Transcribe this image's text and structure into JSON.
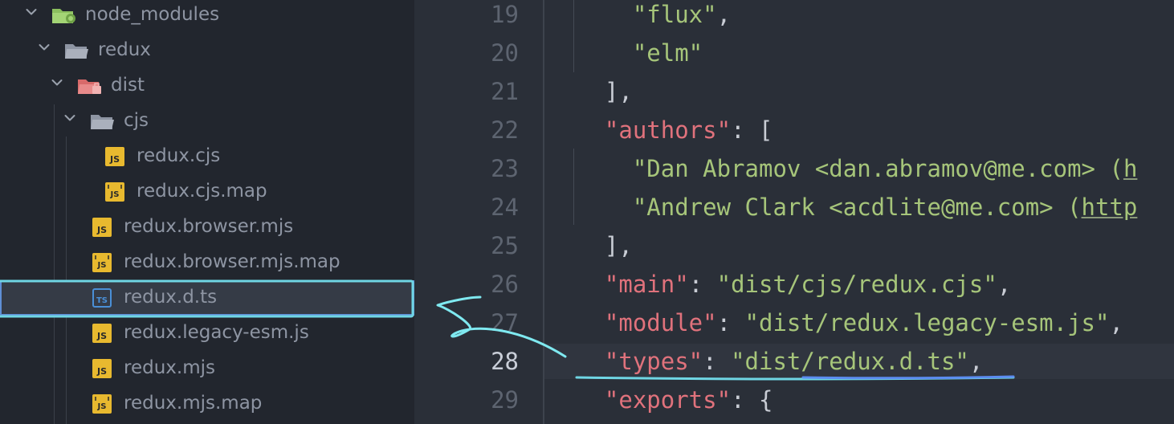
{
  "explorer": {
    "items": [
      {
        "label": "node_modules",
        "kind": "folder",
        "icon": "folder-node-icon",
        "expanded": true,
        "depth": 0
      },
      {
        "label": "redux",
        "kind": "folder",
        "icon": "folder-icon",
        "expanded": true,
        "depth": 1
      },
      {
        "label": "dist",
        "kind": "folder",
        "icon": "folder-dist-icon",
        "expanded": true,
        "depth": 2
      },
      {
        "label": "cjs",
        "kind": "folder",
        "icon": "folder-icon",
        "expanded": true,
        "depth": 3
      },
      {
        "label": "redux.cjs",
        "kind": "file",
        "icon": "js-file-icon",
        "depth": 4
      },
      {
        "label": "redux.cjs.map",
        "kind": "file",
        "icon": "js-map-file-icon",
        "depth": 4
      },
      {
        "label": "redux.browser.mjs",
        "kind": "file",
        "icon": "js-file-icon",
        "depth": 3
      },
      {
        "label": "redux.browser.mjs.map",
        "kind": "file",
        "icon": "js-map-file-icon",
        "depth": 3
      },
      {
        "label": "redux.d.ts",
        "kind": "file",
        "icon": "ts-file-icon",
        "depth": 3,
        "selected": true
      },
      {
        "label": "redux.legacy-esm.js",
        "kind": "file",
        "icon": "js-file-icon",
        "depth": 3
      },
      {
        "label": "redux.mjs",
        "kind": "file",
        "icon": "js-file-icon",
        "depth": 3
      },
      {
        "label": "redux.mjs.map",
        "kind": "file",
        "icon": "js-map-file-icon",
        "depth": 3
      }
    ]
  },
  "editor": {
    "current_line": 28,
    "lines": [
      {
        "number": "19",
        "tokens": [
          {
            "t": "    ",
            "c": "punc"
          },
          {
            "t": "\"flux\"",
            "c": "str"
          },
          {
            "t": ",",
            "c": "punc"
          }
        ]
      },
      {
        "number": "20",
        "tokens": [
          {
            "t": "    ",
            "c": "punc"
          },
          {
            "t": "\"elm\"",
            "c": "str"
          }
        ]
      },
      {
        "number": "21",
        "tokens": [
          {
            "t": "  ],",
            "c": "punc"
          }
        ]
      },
      {
        "number": "22",
        "tokens": [
          {
            "t": "  ",
            "c": "punc"
          },
          {
            "t": "\"authors\"",
            "c": "key"
          },
          {
            "t": ": [",
            "c": "punc"
          }
        ]
      },
      {
        "number": "23",
        "tokens": [
          {
            "t": "    ",
            "c": "punc"
          },
          {
            "t": "\"Dan Abramov <dan.abramov@me.com> (",
            "c": "str"
          },
          {
            "t": "h",
            "c": "url"
          }
        ]
      },
      {
        "number": "24",
        "tokens": [
          {
            "t": "    ",
            "c": "punc"
          },
          {
            "t": "\"Andrew Clark <acdlite@me.com> (",
            "c": "str"
          },
          {
            "t": "http",
            "c": "url"
          }
        ]
      },
      {
        "number": "25",
        "tokens": [
          {
            "t": "  ],",
            "c": "punc"
          }
        ]
      },
      {
        "number": "26",
        "tokens": [
          {
            "t": "  ",
            "c": "punc"
          },
          {
            "t": "\"main\"",
            "c": "key"
          },
          {
            "t": ": ",
            "c": "punc"
          },
          {
            "t": "\"dist/cjs/redux.cjs\"",
            "c": "str"
          },
          {
            "t": ",",
            "c": "punc"
          }
        ]
      },
      {
        "number": "27",
        "tokens": [
          {
            "t": "  ",
            "c": "punc"
          },
          {
            "t": "\"module\"",
            "c": "key"
          },
          {
            "t": ": ",
            "c": "punc"
          },
          {
            "t": "\"dist/redux.legacy-esm.js\"",
            "c": "str"
          },
          {
            "t": ",",
            "c": "punc"
          }
        ]
      },
      {
        "number": "28",
        "tokens": [
          {
            "t": "  ",
            "c": "punc"
          },
          {
            "t": "\"types\"",
            "c": "key"
          },
          {
            "t": ": ",
            "c": "punc"
          },
          {
            "t": "\"dist/redux.d.ts\"",
            "c": "str"
          },
          {
            "t": ",",
            "c": "punc"
          }
        ]
      },
      {
        "number": "29",
        "tokens": [
          {
            "t": "  ",
            "c": "punc"
          },
          {
            "t": "\"exports\"",
            "c": "key"
          },
          {
            "t": ": {",
            "c": "punc"
          }
        ]
      }
    ]
  },
  "colors": {
    "selection_border": "#5f8fd6",
    "annotation_cyan": "#7fe9f0",
    "annotation_blue": "#5b8cf0",
    "key": "#e0727c",
    "string": "#a6c57a"
  }
}
